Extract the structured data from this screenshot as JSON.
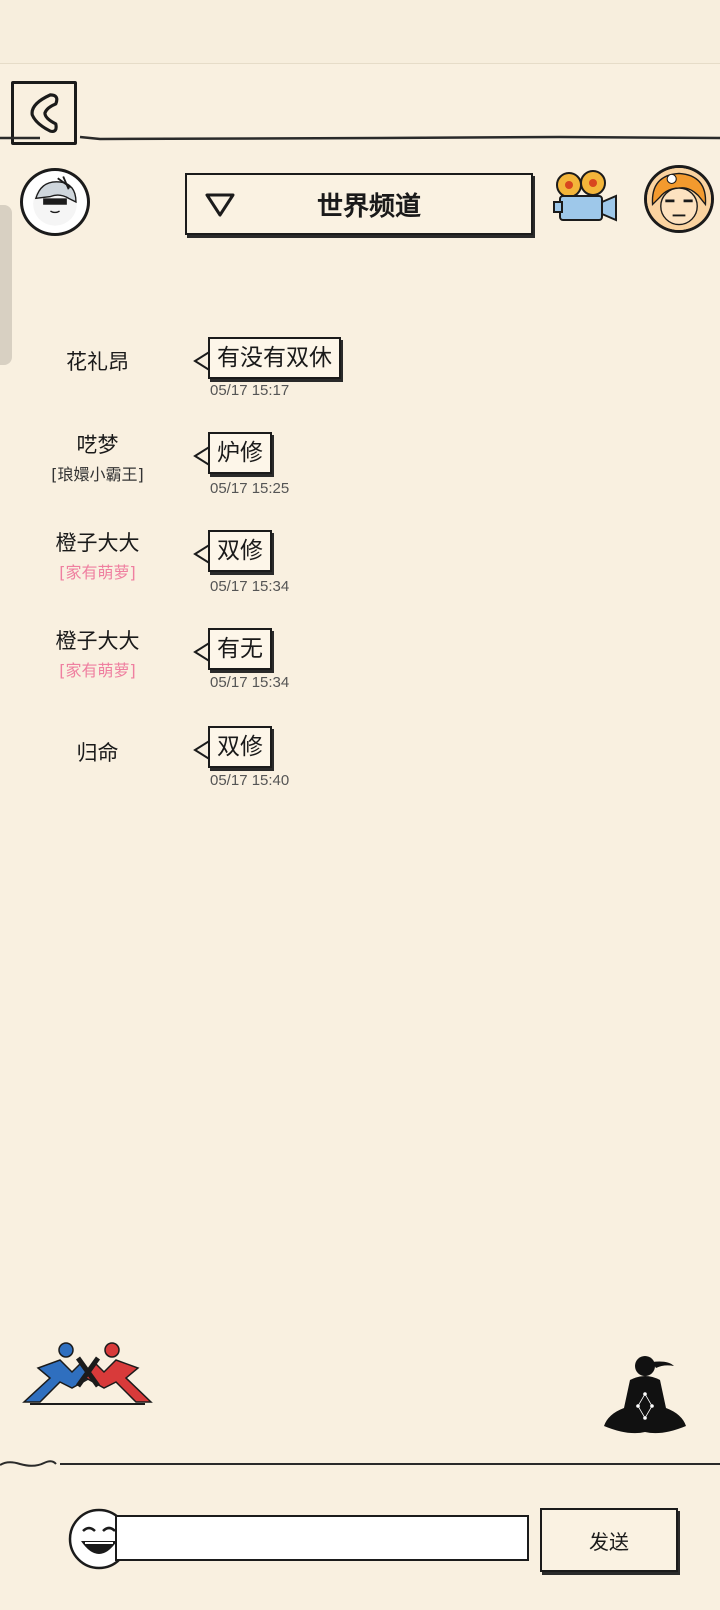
{
  "header": {
    "channel_title": "世界频道"
  },
  "messages": [
    {
      "name": "花礼昂",
      "title": "",
      "text": "有没有双休",
      "time": "05/17 15:17"
    },
    {
      "name": "呓梦",
      "title": "[琅嬛小霸王]",
      "title_color": "#333333",
      "text": "炉修",
      "time": "05/17 15:25"
    },
    {
      "name": "橙子大大",
      "title": "[家有萌萝]",
      "title_color": "#ef7fa0",
      "text": "双修",
      "time": "05/17 15:34"
    },
    {
      "name": "橙子大大",
      "title": "[家有萌萝]",
      "title_color": "#ef7fa0",
      "text": "有无",
      "time": "05/17 15:34"
    },
    {
      "name": "归命",
      "title": "",
      "text": "双修",
      "time": "05/17 15:40"
    }
  ],
  "footer": {
    "input_value": "",
    "send_label": "发送"
  },
  "icons": {
    "back": "back-arrow-icon",
    "dropdown": "triangle-down-icon",
    "camera": "movie-camera-icon",
    "pvp": "pvp-fighters-icon",
    "meditate": "meditation-icon",
    "emoji": "smile-emoji-icon"
  },
  "colors": {
    "background": "#f9f0e0",
    "pink_title": "#ef7fa0",
    "ink": "#1b1b1b"
  }
}
